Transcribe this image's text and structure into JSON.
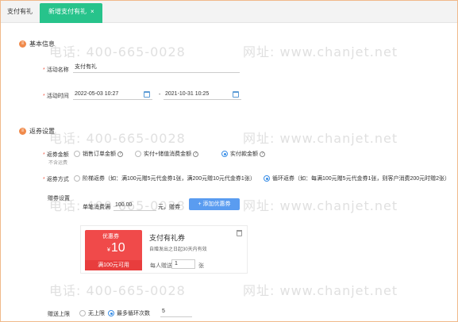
{
  "tabs": [
    {
      "label": "支付有礼",
      "active": false
    },
    {
      "label": "新增支付有礼",
      "active": true,
      "close": "×"
    }
  ],
  "colors": {
    "accent_tab": "#27c38b",
    "primary": "#5a9cf0",
    "coupon": "#f04a4a",
    "required": "#f25f4c"
  },
  "basic": {
    "title": "基本信息",
    "name_label": "活动名称",
    "name_value": "支付有礼",
    "time_label": "活动时间",
    "start": "2022-05-03 10:27",
    "sep": "-",
    "end": "2021-10-31 10:25"
  },
  "rebate": {
    "title": "返券设置",
    "amount_label": "返券金额",
    "amount_sub": "不含运费",
    "amount_options": [
      {
        "label": "销售订单金额",
        "checked": false
      },
      {
        "label": "实付+储值消费金额",
        "checked": false
      },
      {
        "label": "实付款金额",
        "checked": true
      }
    ],
    "mode_label": "返券方式",
    "mode_options": [
      {
        "label": "阶梯返券（如：满100元赠5元代金券1张，满200元赠10元代金券1张）",
        "checked": false
      },
      {
        "label": "循环返券（如：每满100元赠5元代金券1张，则客户消费200元时赠2张）",
        "checked": true
      }
    ],
    "gift_label": "赠券设置",
    "single_prefix": "单笔消费满",
    "single_value": "100.00",
    "single_suffix": "元，赠券",
    "add_button": "+ 添加优惠券"
  },
  "coupon": {
    "type": "优惠券",
    "currency": "¥",
    "amount": "10",
    "condition": "满100元可用",
    "name": "支付有礼券",
    "validity": "自赠发出之日起30天内有效",
    "per_label": "每人赠送",
    "per_value": "1",
    "per_unit": "张"
  },
  "limit": {
    "label": "赠送上限",
    "options": [
      {
        "label": "无上限",
        "checked": false
      },
      {
        "label": "最多循环次数",
        "checked": true
      }
    ],
    "value": "5"
  },
  "watermark": {
    "phone": "电话: 400-665-0028",
    "site": "网址: www.chanjet.net"
  }
}
